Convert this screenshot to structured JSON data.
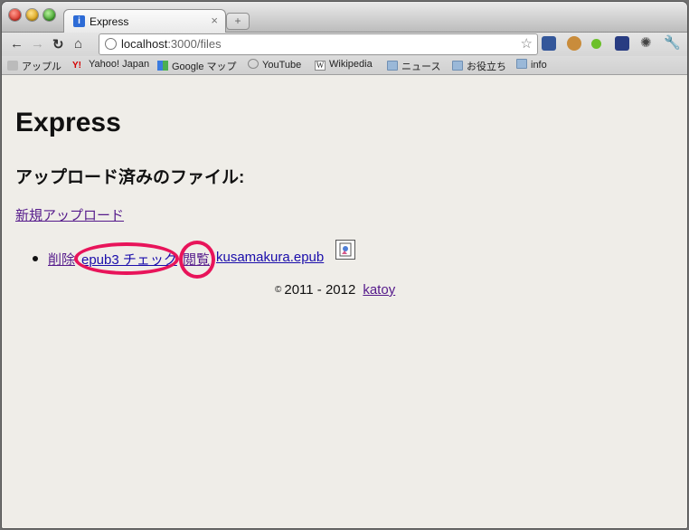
{
  "browser": {
    "tab_title": "Express",
    "tab_favicon": "i",
    "tab_close": "×",
    "newtab": "+",
    "url_host": "localhost",
    "url_path": ":3000/files"
  },
  "bookmarks": [
    {
      "label": "アップル"
    },
    {
      "label": "Yahoo! Japan"
    },
    {
      "label": "Google マップ"
    },
    {
      "label": "YouTube"
    },
    {
      "label": "Wikipedia"
    },
    {
      "label": "ニュース"
    },
    {
      "label": "お役立ち"
    },
    {
      "label": "info"
    }
  ],
  "page": {
    "title": "Express",
    "subtitle": "アップロード済みのファイル:",
    "upload_link": "新規アップロード",
    "files": [
      {
        "delete": "削除",
        "check": "epub3 チェック",
        "view": "閲覧",
        "name": "kusamakura.epub"
      }
    ],
    "footer": {
      "copy_symbol": "©",
      "years": "2011 - 2012",
      "author": "katoy"
    }
  },
  "colors": {
    "annotation_ring": "#e8145a",
    "link": "#1a0dab",
    "visited_link": "#551a8b"
  }
}
